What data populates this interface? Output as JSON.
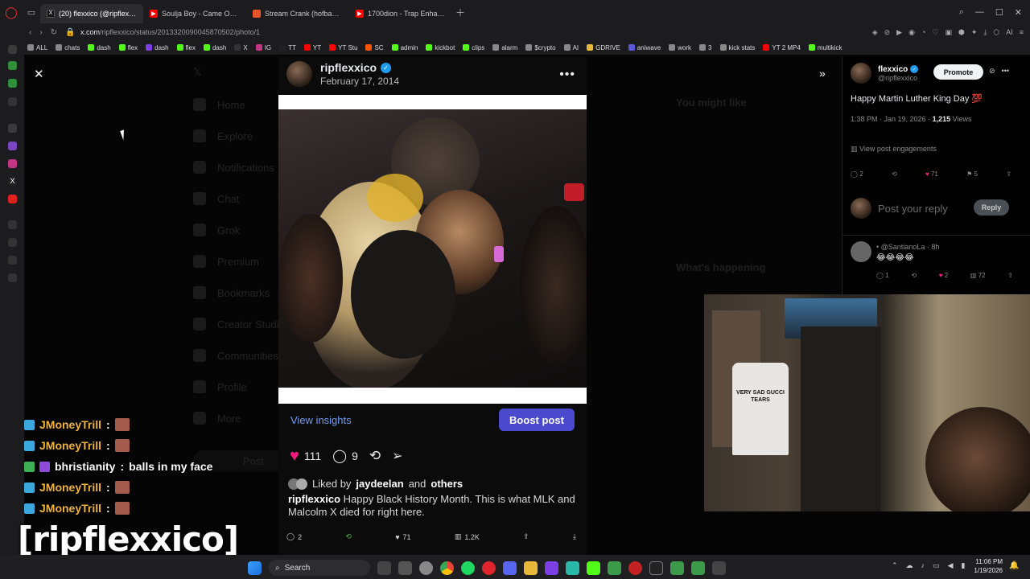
{
  "browser": {
    "tabs": [
      {
        "title": "(20) flexxico (@ripflexxico",
        "color": "#1d1d1d",
        "active": true
      },
      {
        "title": "Soulja Boy - Came Out Th",
        "color": "#ff0000",
        "active": false
      },
      {
        "title": "Stream Crank (hofbadge",
        "color": "#e8542a",
        "active": false
      },
      {
        "title": "1700dion - Trap Enhanced",
        "color": "#ff0000",
        "active": false
      }
    ],
    "url_host": "x.com",
    "url_path": "/ripflexxico/status/2013320090045870502/photo/1",
    "bookmarks": [
      "ALL",
      "chats",
      "dash",
      "flex",
      "dash",
      "flex",
      "dash",
      "X",
      "IG",
      "TT",
      "YT",
      "YT Stu",
      "SC",
      "admin",
      "kickbot",
      "clips",
      "alarm",
      "$crypto",
      "AI",
      "GDRIVE",
      "aniwave",
      "work",
      "3",
      "kick stats",
      "YT 2 MP4",
      "multikick"
    ]
  },
  "x_nav": [
    "Home",
    "Explore",
    "Notifications",
    "Chat",
    "Grok",
    "Premium",
    "Bookmarks",
    "Creator Studio",
    "Communities",
    "Profile",
    "More"
  ],
  "post_button": "Post",
  "bg_right": {
    "you_might_like": "You might like",
    "whats_happening": "What's happening"
  },
  "photo_post": {
    "username": "ripflexxico",
    "date": "February 17, 2014",
    "insights": "View insights",
    "boost": "Boost post",
    "likes": "111",
    "replies": "9",
    "liked_by_prefix": "Liked by",
    "liked_by_user": "jaydeelan",
    "liked_by_and": "and",
    "liked_by_others": "others",
    "caption_user": "ripflexxico",
    "caption_text": "Happy Black History Month. This is what MLK and Malcolm X died for right here."
  },
  "bottom_bar": {
    "replies": "2",
    "likes": "71",
    "views": "1.2K"
  },
  "side_post": {
    "name": "flexxico",
    "handle": "@ripflexxico",
    "promote": "Promote",
    "text": "Happy Martin Luther King Day 💯",
    "time": "1:38 PM · Jan 19, 2026 ·",
    "views_count": "1,215",
    "views_label": "Views",
    "engagements": "View post engagements",
    "replies": "2",
    "likes": "71",
    "bookmarks": "5",
    "reply_placeholder": "Post your reply",
    "reply_button": "Reply",
    "comment_handle": "• @SantianoLa · 8h",
    "comment_text": "😂😂😂😂",
    "comment_replies": "1",
    "comment_likes": "2",
    "comment_views": "72"
  },
  "chat": [
    {
      "user": "JMoneyTrill",
      "sep": ":",
      "msg": ""
    },
    {
      "user": "JMoneyTrill",
      "sep": ":",
      "msg": ""
    },
    {
      "user": "bhristianity",
      "sep": ":",
      "msg": "balls in my face"
    },
    {
      "user": "JMoneyTrill",
      "sep": ":",
      "msg": ""
    },
    {
      "user": "JMoneyTrill",
      "sep": ":",
      "msg": ""
    }
  ],
  "overlay_name": "[ripflexxico]",
  "shirt_text": "VERY SAD GUCCI TEARS",
  "taskbar": {
    "search": "Search",
    "time": "11:06 PM",
    "date": "1/19/2026"
  }
}
